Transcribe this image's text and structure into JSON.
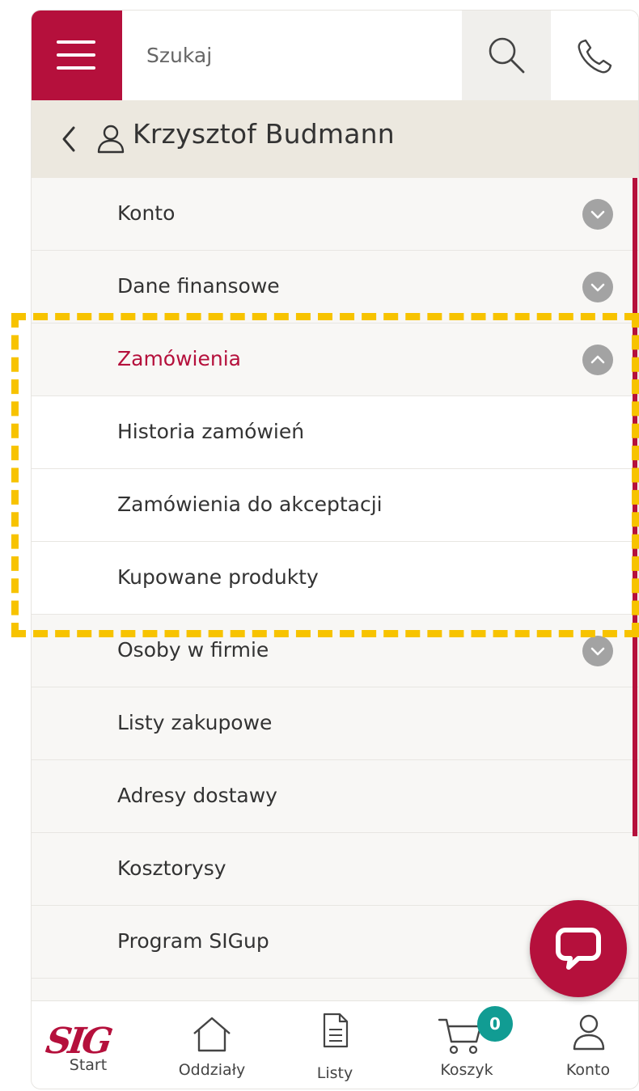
{
  "header": {
    "search_placeholder": "Szukaj",
    "menu_icon": "hamburger-icon",
    "search_icon": "search-icon",
    "phone_icon": "phone-icon"
  },
  "profile": {
    "name": "Krzysztof Budmann",
    "back_icon": "chevron-left-icon",
    "user_icon": "user-icon"
  },
  "menu": {
    "items": [
      {
        "label": "Konto",
        "chevron": "chevron-down"
      },
      {
        "label": "Dane finansowe",
        "chevron": "chevron-down"
      },
      {
        "label": "Zamówienia",
        "chevron": "chevron-up",
        "active": true
      },
      {
        "label": "Historia zamówień",
        "sub": true
      },
      {
        "label": "Zamówienia do akceptacji",
        "sub": true
      },
      {
        "label": "Kupowane produkty",
        "sub": true
      },
      {
        "label": "Osoby w firmie",
        "chevron": "chevron-down"
      },
      {
        "label": "Listy zakupowe"
      },
      {
        "label": "Adresy dostawy"
      },
      {
        "label": "Kosztorysy"
      },
      {
        "label": "Program SIGup"
      }
    ]
  },
  "bottom_nav": {
    "logo_text": "SIG",
    "start": "Start",
    "branches": "Oddziały",
    "lists": "Listy",
    "cart": "Koszyk",
    "cart_count": "0",
    "account": "Konto"
  },
  "colors": {
    "brand": "#b5103c",
    "highlight": "#f7c300",
    "badge": "#119c93"
  }
}
